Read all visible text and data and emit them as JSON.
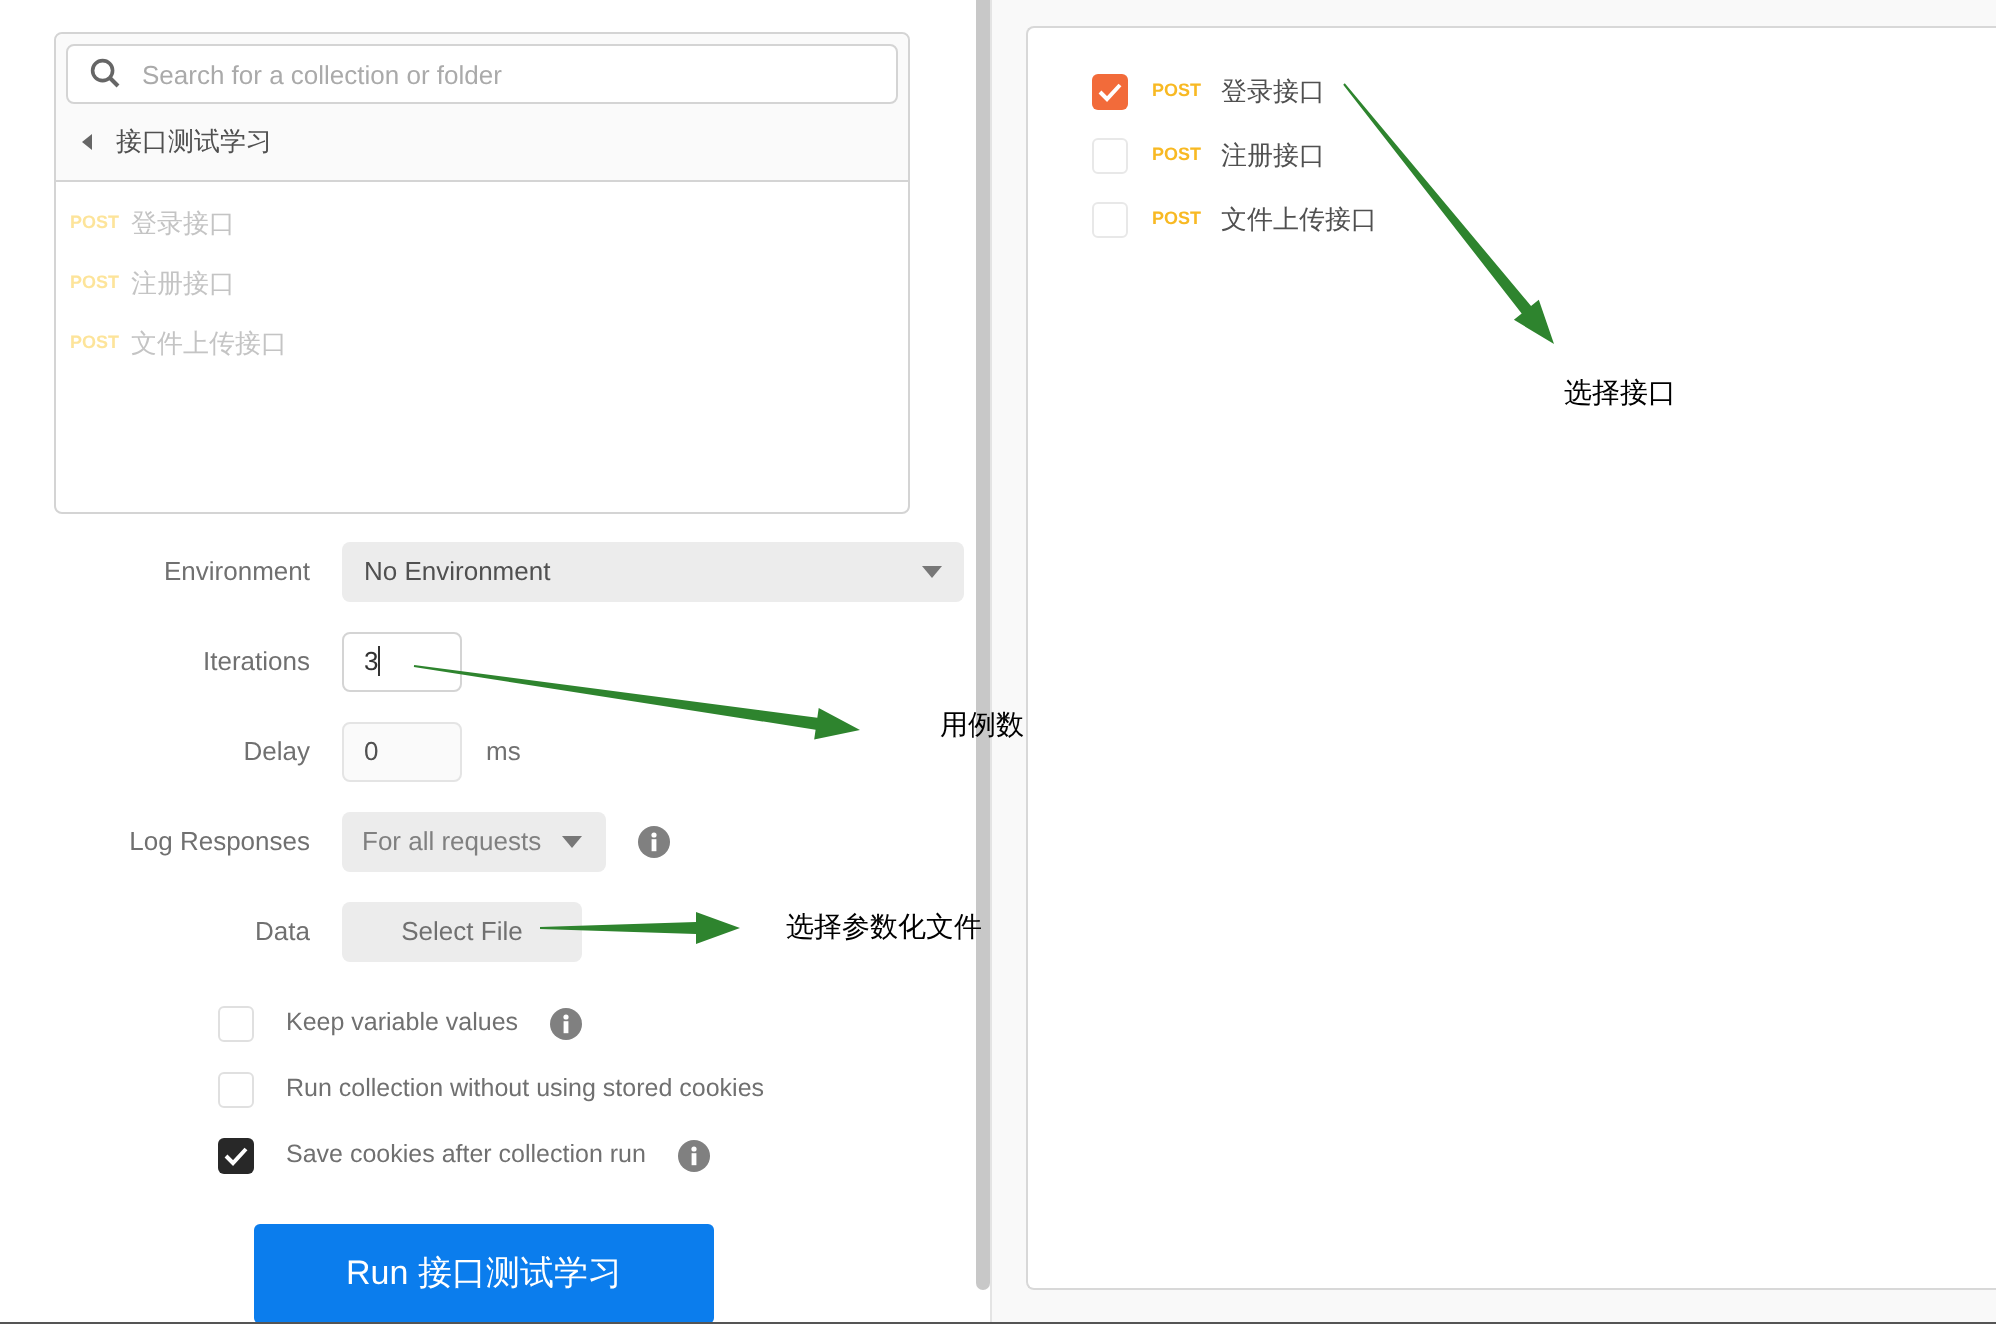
{
  "collection_picker": {
    "search": {
      "placeholder": "Search for a collection or folder"
    },
    "folder": "接口测试学习",
    "requests": [
      {
        "method": "POST",
        "name": "登录接口"
      },
      {
        "method": "POST",
        "name": "注册接口"
      },
      {
        "method": "POST",
        "name": "文件上传接口"
      }
    ]
  },
  "settings": {
    "environment": {
      "label": "Environment",
      "value": "No Environment"
    },
    "iterations": {
      "label": "Iterations",
      "value": "3"
    },
    "delay": {
      "label": "Delay",
      "value": "0",
      "unit": "ms"
    },
    "log_responses": {
      "label": "Log Responses",
      "value": "For all requests"
    },
    "data": {
      "label": "Data",
      "button": "Select File"
    }
  },
  "options": [
    {
      "label": "Keep variable values",
      "checked": false,
      "info": true
    },
    {
      "label": "Run collection without using stored cookies",
      "checked": false,
      "info": false
    },
    {
      "label": "Save cookies after collection run",
      "checked": true,
      "info": true
    }
  ],
  "run_button": "Run 接口测试学习",
  "run_order": [
    {
      "method": "POST",
      "name": "登录接口",
      "checked": true
    },
    {
      "method": "POST",
      "name": "注册接口",
      "checked": false
    },
    {
      "method": "POST",
      "name": "文件上传接口",
      "checked": false
    }
  ],
  "annotations": [
    {
      "text": "用例数"
    },
    {
      "text": "选择参数化文件"
    },
    {
      "text": "选择接口"
    }
  ]
}
